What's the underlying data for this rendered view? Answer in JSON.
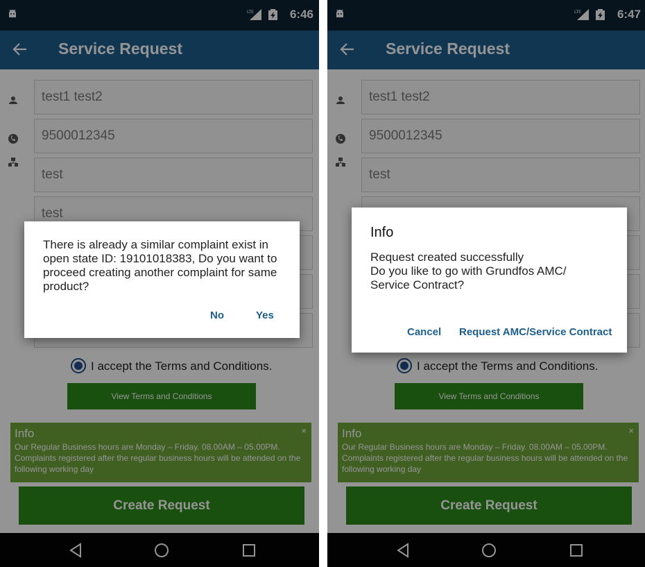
{
  "colors": {
    "status_bar": "#0d2233",
    "app_bar": "#1c5e8e",
    "green_button": "#2e8a1b",
    "info_box": "#6ea53b",
    "dialog_button_text": "#1c5e8e"
  },
  "left": {
    "status_time": "6:46",
    "app_title": "Service Request",
    "fields": [
      {
        "icon": "person-icon",
        "value": "test1 test2"
      },
      {
        "icon": "phone-icon",
        "value": "9500012345"
      },
      {
        "icon": "address-icon",
        "value": "test"
      },
      {
        "value": "test"
      }
    ],
    "terms_label": "I accept the Terms and Conditions.",
    "view_terms_label": "View Terms and Conditions",
    "info": {
      "title": "Info",
      "close": "×",
      "text": "Our Regular Business hours are Monday – Friday. 08.00AM – 05.00PM. Complaints registered after the regular business hours will be attended on the following working day"
    },
    "create_label": "Create Request",
    "dialog": {
      "message": "There is already a similar complaint exist in open state ID: 19101018383, Do you want to proceed creating another complaint for same product?",
      "no_label": "No",
      "yes_label": "Yes"
    }
  },
  "right": {
    "status_time": "6:47",
    "app_title": "Service Request",
    "fields": [
      {
        "icon": "person-icon",
        "value": "test1 test2"
      },
      {
        "icon": "phone-icon",
        "value": "9500012345"
      },
      {
        "icon": "address-icon",
        "value": "test"
      }
    ],
    "terms_label": "I accept the Terms and Conditions.",
    "view_terms_label": "View Terms and Conditions",
    "info": {
      "title": "Info",
      "close": "×",
      "text": "Our Regular Business hours are Monday – Friday. 08.00AM – 05.00PM. Complaints registered after the regular business hours will be attended on the following working day"
    },
    "create_label": "Create Request",
    "dialog": {
      "title": "Info",
      "message_line1": "Request created successfully",
      "message_line2": "Do you like to go with Grundfos AMC/ Service Contract?",
      "cancel_label": "Cancel",
      "request_label": "Request AMC/Service Contract"
    }
  }
}
